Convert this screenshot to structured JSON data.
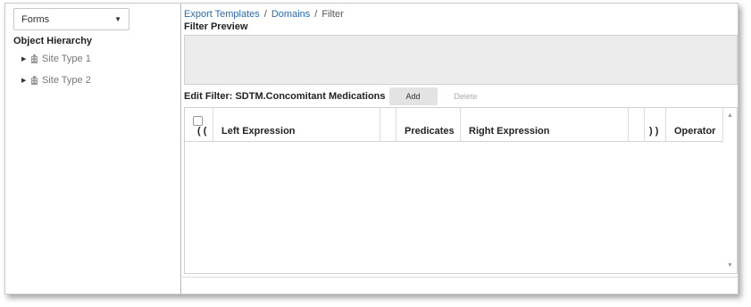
{
  "sidebar": {
    "dropdown": {
      "selected": "Forms"
    },
    "hierarchy_title": "Object Hierarchy",
    "items": [
      {
        "label": "Site Type 1",
        "icon": "building-icon"
      },
      {
        "label": "Site Type 2",
        "icon": "building-icon"
      }
    ]
  },
  "breadcrumb": {
    "items": [
      "Export Templates",
      "Domains",
      "Filter"
    ],
    "separator": "/"
  },
  "preview": {
    "title": "Filter Preview"
  },
  "edit": {
    "label": "Edit Filter: SDTM.Concomitant Medications",
    "add_label": "Add",
    "delete_label": "Delete"
  },
  "grid": {
    "columns": [
      "( (",
      "Left Expression",
      "",
      "Predicates",
      "Right Expression",
      "",
      ") )",
      "Operator"
    ],
    "rows": []
  },
  "colors": {
    "link": "#2a6ab0",
    "preview_bg": "#ececec",
    "muted_text": "#777777"
  }
}
